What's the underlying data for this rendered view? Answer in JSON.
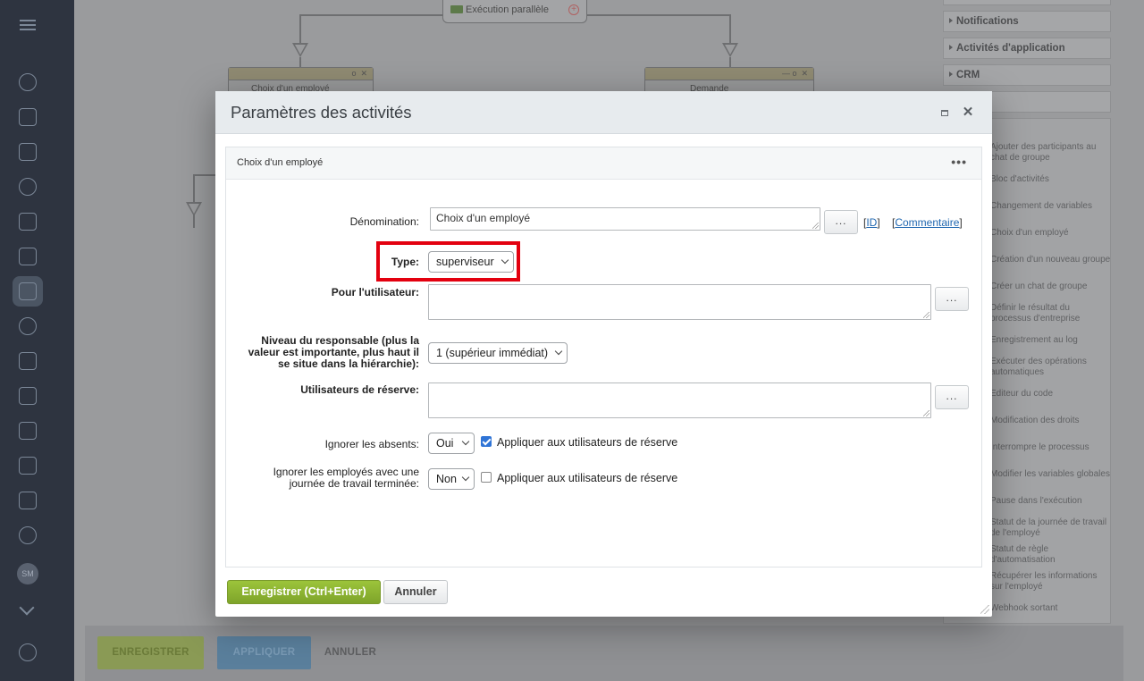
{
  "background": {
    "user_initials": "SM",
    "workflow": {
      "parallel_block": "Exécution parallèle",
      "block_left": "Choix d'un employé",
      "block_right": "Demande"
    },
    "right_panel": {
      "sections": [
        "Notifications",
        "Activités d'application",
        "CRM"
      ],
      "items": [
        "Ajouter des participants au chat de groupe",
        "Bloc d'activités",
        "Changement de variables",
        "Choix d'un employé",
        "Création d'un nouveau groupe",
        "Créer un chat de groupe",
        "Définir le résultat du processus d'entreprise",
        "Enregistrement au log",
        "Exécuter des opérations automatiques",
        "Éditeur du code",
        "Modification des droits",
        "Interrompre le processus",
        "Modifier les variables globales",
        "Pause dans l'exécution",
        "Statut de la journée de travail de l'employé",
        "Statut de règle d'automatisation",
        "Récupérer les informations sur l'employé",
        "Webhook sortant"
      ]
    },
    "bottom": {
      "save": "ENREGISTRER",
      "apply": "APPLIQUER",
      "cancel": "ANNULER"
    }
  },
  "dialog": {
    "title": "Paramètres des activités",
    "panel_title": "Choix d'un employé",
    "panel_menu": "•••",
    "fields": {
      "name_label": "Dénomination:",
      "name_value": "Choix d'un employé",
      "dots": "...",
      "id_link": "ID",
      "comment_link": "Commentaire",
      "type_label": "Type:",
      "type_value": "superviseur",
      "for_user_label": "Pour l'utilisateur:",
      "level_label": "Niveau du responsable (plus la valeur est importante, plus haut il se situe dans la hiérarchie):",
      "level_value": "1 (supérieur immédiat)",
      "reserve_label": "Utilisateurs de réserve:",
      "ignore_absent_label": "Ignorer les absents:",
      "ignore_absent_value": "Oui",
      "apply_reserve_1": "Appliquer aux utilisateurs de réserve",
      "apply_reserve_1_checked": true,
      "ignore_finished_label": "Ignorer les employés avec une journée de travail terminée:",
      "ignore_finished_value": "Non",
      "apply_reserve_2": "Appliquer aux utilisateurs de réserve",
      "apply_reserve_2_checked": false
    },
    "buttons": {
      "save": "Enregistrer (Ctrl+Enter)",
      "cancel": "Annuler"
    }
  }
}
